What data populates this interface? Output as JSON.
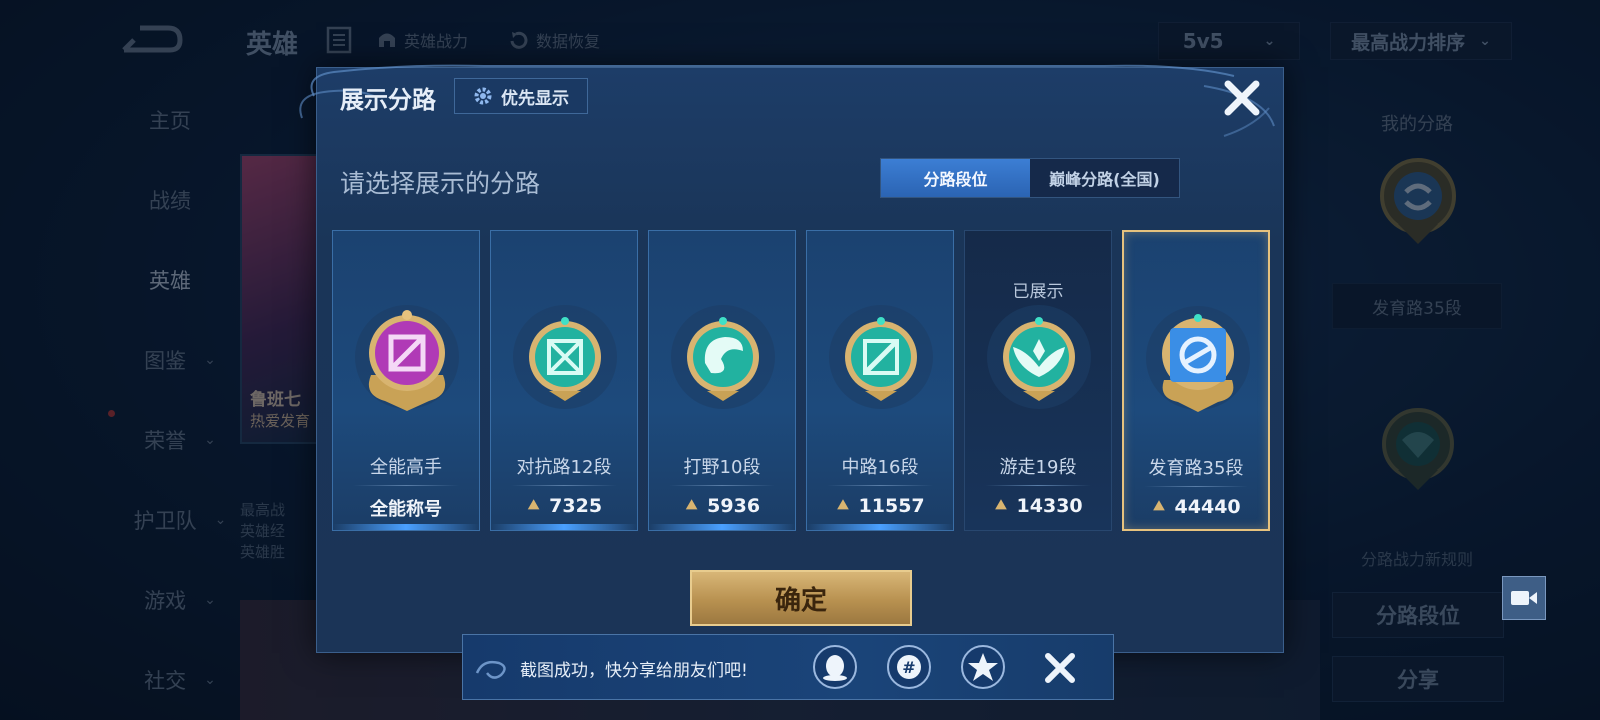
{
  "topbar": {
    "title": "英雄",
    "hero_power_label": "英雄战力",
    "data_restore_label": "数据恢复",
    "mode_value": "5v5",
    "sort_value": "最高战力排序"
  },
  "sidebar": {
    "items": [
      {
        "label": "主页"
      },
      {
        "label": "战绩"
      },
      {
        "label": "英雄"
      },
      {
        "label": "图鉴"
      },
      {
        "label": "荣誉"
      },
      {
        "label": "护卫队"
      },
      {
        "label": "游戏"
      },
      {
        "label": "社交"
      }
    ]
  },
  "hero_card": {
    "name": "鲁班七",
    "tag": "热爱发育",
    "info": [
      "最高战",
      "英雄经",
      "英雄胜"
    ]
  },
  "right_panel": {
    "title": "我的分路",
    "lane_label": "发育路35段",
    "rule_link": "分路战力新规则",
    "lane_rank_button": "分路段位",
    "share_button": "分享"
  },
  "modal": {
    "title": "展示分路",
    "priority_button": "优先显示",
    "subtitle": "请选择展示的分路",
    "tabs": [
      {
        "label": "分路段位",
        "active": true
      },
      {
        "label": "巅峰分路(全国)",
        "active": false
      }
    ],
    "lanes": [
      {
        "name": "全能高手",
        "footer": "全能称号",
        "badge": "all-rounder-icon",
        "color": "#b03ab6"
      },
      {
        "name": "对抗路12段",
        "power": "7325",
        "badge": "clash-lane-icon",
        "color": "#22b2a0"
      },
      {
        "name": "打野10段",
        "power": "5936",
        "badge": "jungle-icon",
        "color": "#22b2a0"
      },
      {
        "name": "中路16段",
        "power": "11557",
        "badge": "mid-lane-icon",
        "color": "#22b2a0"
      },
      {
        "name": "游走19段",
        "power": "14330",
        "badge": "roam-icon",
        "color": "#22b2a0",
        "shown_tag": "已展示"
      },
      {
        "name": "发育路35段",
        "power": "44440",
        "badge": "farm-lane-icon",
        "color": "#3a8ee6",
        "selected": true
      }
    ],
    "confirm_button": "确定"
  },
  "toast": {
    "message": "截图成功，快分享给朋友们吧!",
    "share_targets": [
      "qq-icon",
      "wechat-moments-icon",
      "qzone-icon"
    ]
  }
}
